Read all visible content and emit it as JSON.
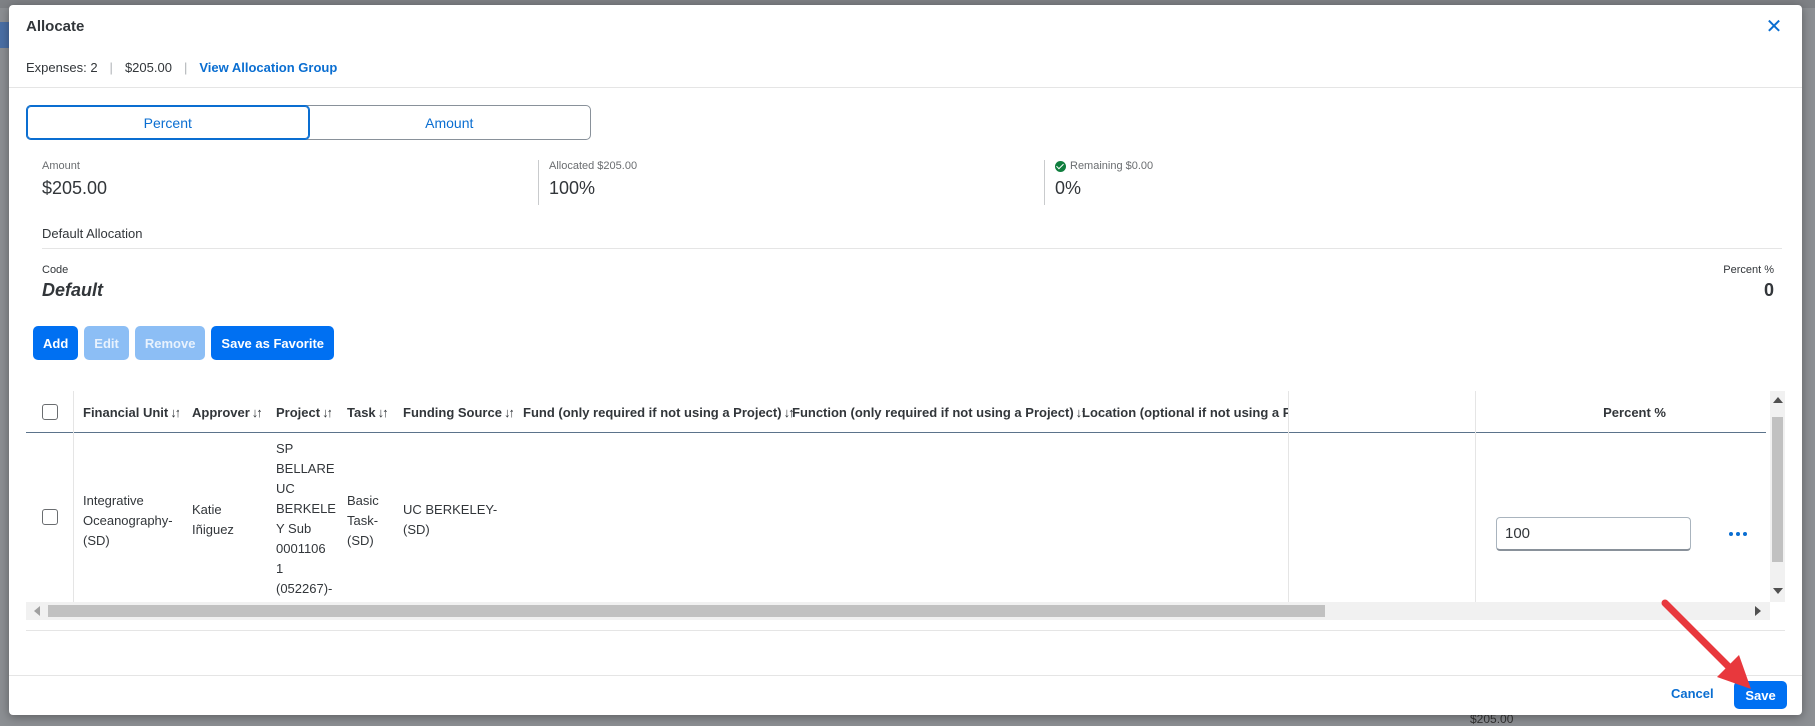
{
  "dialog": {
    "title": "Allocate",
    "close_icon": "close-icon"
  },
  "header": {
    "expenses": "Expenses: 2",
    "total": "$205.00",
    "view_group_link": "View Allocation Group"
  },
  "mode": {
    "options": [
      "Percent",
      "Amount"
    ],
    "selected": "Percent"
  },
  "summary": {
    "amount_label": "Amount",
    "amount_value": "$205.00",
    "allocated_label": "Allocated $205.00",
    "allocated_value": "100%",
    "remaining_label": "Remaining $0.00",
    "remaining_value": "0%",
    "remaining_icon": "check-circle-icon",
    "remaining_color": "#107e3e"
  },
  "default_allocation": {
    "section_title": "Default Allocation",
    "code_label": "Code",
    "code_value": "Default",
    "percent_label": "Percent %",
    "percent_value": "0"
  },
  "toolbar": {
    "add": "Add",
    "edit": "Edit",
    "remove": "Remove",
    "save_favorite": "Save as Favorite"
  },
  "table": {
    "columns": [
      "Financial Unit",
      "Approver",
      "Project",
      "Task",
      "Funding Source",
      "Fund (only required if not using a Project)",
      "Function (only required if not using a Project)",
      "Location (optional if not using a Pro",
      "Percent %"
    ],
    "sort_icon": "↓↑",
    "rows": [
      {
        "financial_unit": [
          "Integrative",
          "Oceanography-",
          "(SD)"
        ],
        "approver": [
          "Katie",
          "Iñiguez"
        ],
        "project": [
          "SP",
          "BELLARE",
          "UC",
          "BERKELE",
          "Y Sub",
          "0001106",
          "1",
          "(052267)-"
        ],
        "task": [
          "Basic",
          "Task-",
          "(SD)"
        ],
        "funding_source": [
          "UC BERKELEY-",
          "(SD)"
        ],
        "percent": "100",
        "more_icon": "more-options-icon"
      }
    ]
  },
  "footer": {
    "cancel": "Cancel",
    "save": "Save"
  },
  "colors": {
    "accent": "#0a6ed1",
    "button": "#0070f2",
    "annotation_arrow": "#e8383d"
  },
  "background": {
    "bottom_amount": "$205.00"
  }
}
